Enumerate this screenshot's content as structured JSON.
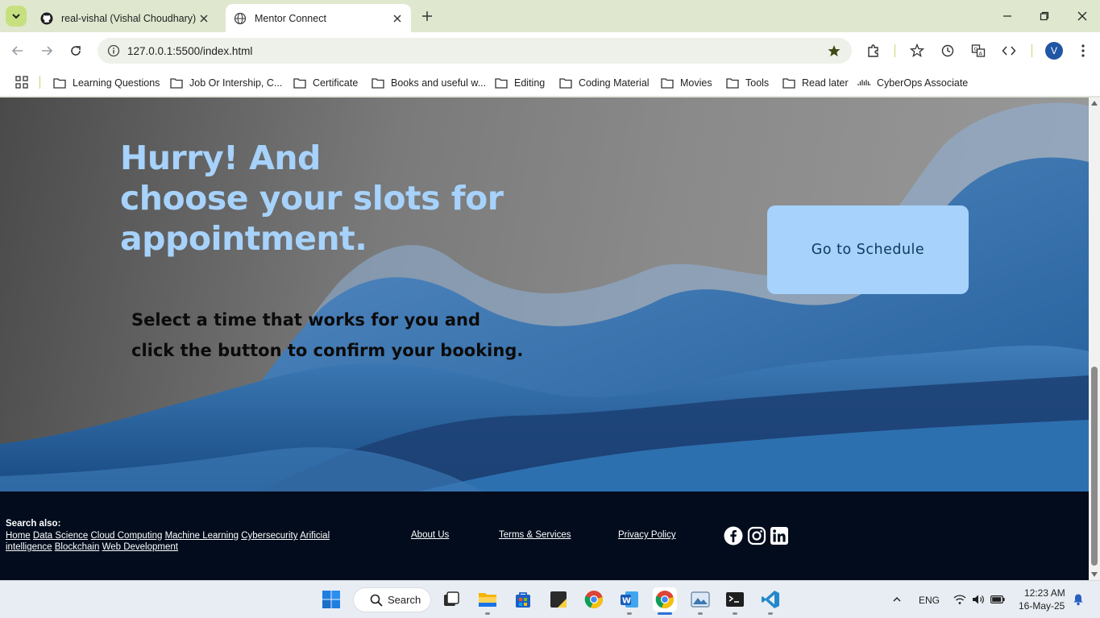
{
  "browser": {
    "tabs": [
      {
        "title": "real-vishal (Vishal Choudhary)",
        "active": false
      },
      {
        "title": "Mentor Connect",
        "active": true
      }
    ],
    "url": "127.0.0.1:5500/index.html",
    "profile_initial": "V",
    "bookmarks": [
      "Learning Questions",
      "Job Or Intership,  C...",
      "Certificate",
      "Books and useful w...",
      "Editing",
      "Coding Material",
      "Movies",
      "Tools",
      "Read later",
      "CyberOps Associate"
    ]
  },
  "hero": {
    "heading_line1": "Hurry! And",
    "heading_line2": "choose your slots for",
    "heading_line3": "appointment.",
    "subtext_line1": "Select a time that works for you and",
    "subtext_line2": "click the button to confirm your booking.",
    "button_label": "Go to Schedule"
  },
  "footer": {
    "search_label": "Search also:",
    "links": [
      "Home",
      "Data Science",
      "Cloud Computing",
      "Machine Learning",
      "Cybersecurity",
      "Arificial intelligence",
      "Blockchain",
      "Web Development"
    ],
    "about": "About Us",
    "terms": "Terms & Services",
    "privacy": "Privacy Policy",
    "social_icons": [
      "facebook-icon",
      "instagram-icon",
      "linkedin-icon"
    ]
  },
  "taskbar": {
    "search_label": "Search",
    "language": "ENG",
    "time": "12:23 AM",
    "date": "16-May-25"
  },
  "colors": {
    "hero_heading": "#a6d2fb",
    "button_bg": "#a6d2fb",
    "button_text": "#0e3a5e",
    "footer_bg": "#020c1c",
    "wave_blue": "#2f6fae"
  }
}
